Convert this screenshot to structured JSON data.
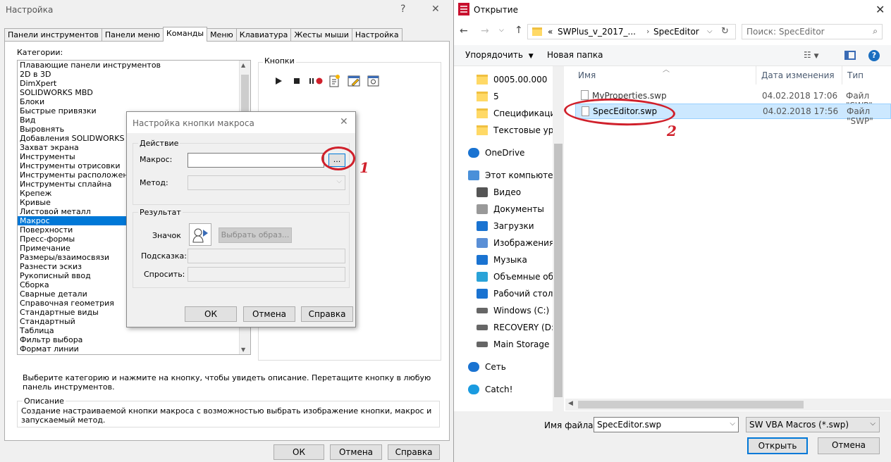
{
  "left": {
    "title": "Настройка",
    "help_glyph": "?",
    "close_glyph": "✕",
    "tabs": [
      "Панели инструментов",
      "Панели меню",
      "Команды",
      "Меню",
      "Клавиатура",
      "Жесты мыши",
      "Настройка"
    ],
    "categories_label": "Категории:",
    "buttons_label": "Кнопки",
    "categories": [
      "Плавающие панели инструментов",
      "2D в 3D",
      "DimXpert",
      "SOLIDWORKS MBD",
      "Блоки",
      "Быстрые привязки",
      "Вид",
      "Выровнять",
      "Добавления SOLIDWORKS",
      "Захват экрана",
      "Инструменты",
      "Инструменты отрисовки",
      "Инструменты расположения",
      "Инструменты сплайна",
      "Крепеж",
      "Кривые",
      "Листовой металл",
      "Макрос",
      "Поверхности",
      "Пресс-формы",
      "Примечание",
      "Размеры/взаимосвязи",
      "Разнести эскиз",
      "Рукописный ввод",
      "Сборка",
      "Сварные детали",
      "Справочная геометрия",
      "Стандартные виды",
      "Стандартный",
      "Таблица",
      "Фильтр выбора",
      "Формат линии"
    ],
    "selected_category": "Макрос",
    "hint_text": "Выберите категорию и нажмите на кнопку, чтобы увидеть описание. Перетащите кнопку в любую панель инструментов.",
    "description_label": "Описание",
    "description_text": "Создание настраиваемой кнопки макроса с возможностью выбрать изображение кнопки, макрос и запускаемый метод.",
    "ok": "ОК",
    "cancel": "Отмена",
    "help": "Справка"
  },
  "dialog": {
    "title": "Настройка кнопки макроса",
    "action_group": "Действие",
    "macro_label": "Макрос:",
    "macro_value": "",
    "browse": "...",
    "method_label": "Метод:",
    "result_group": "Результат",
    "icon_label": "Значок",
    "choose_image": "Выбрать образ...",
    "tooltip_label": "Подсказка:",
    "prompt_label": "Спросить:",
    "ok": "ОК",
    "cancel": "Отмена",
    "help": "Справка"
  },
  "annotations": {
    "one": "1",
    "two": "2"
  },
  "right": {
    "title": "Открытие",
    "path_prefix": "«",
    "path": [
      "SWPlus_v_2017_...",
      "SpecEditor"
    ],
    "search_placeholder": "Поиск: SpecEditor",
    "organize": "Упорядочить",
    "new_folder": "Новая папка",
    "col_name": "Имя",
    "col_date": "Дата изменения",
    "col_type": "Тип",
    "nav_items": [
      {
        "label": "0005.00.000",
        "icon": "folder"
      },
      {
        "label": "5",
        "icon": "folder"
      },
      {
        "label": "Спецификация",
        "icon": "folder"
      },
      {
        "label": "Текстовые урок",
        "icon": "folder"
      },
      {
        "label": "OneDrive",
        "icon": "cloud"
      },
      {
        "label": "Этот компьютер",
        "icon": "computer"
      },
      {
        "label": "Видео",
        "icon": "video"
      },
      {
        "label": "Документы",
        "icon": "documents"
      },
      {
        "label": "Загрузки",
        "icon": "download"
      },
      {
        "label": "Изображения",
        "icon": "pictures"
      },
      {
        "label": "Музыка",
        "icon": "music"
      },
      {
        "label": "Объемные объ",
        "icon": "cube"
      },
      {
        "label": "Рабочий стол",
        "icon": "desktop"
      },
      {
        "label": "Windows (C:)",
        "icon": "drive"
      },
      {
        "label": "RECOVERY (D:)",
        "icon": "drive"
      },
      {
        "label": "Main Storage (F:",
        "icon": "drive"
      },
      {
        "label": "Сеть",
        "icon": "network"
      },
      {
        "label": "Catch!",
        "icon": "catch"
      }
    ],
    "files": [
      {
        "name": "MyProperties.swp",
        "date": "04.02.2018 17:06",
        "type": "Файл \"SWP\""
      },
      {
        "name": "SpecEditor.swp",
        "date": "04.02.2018 17:56",
        "type": "Файл \"SWP\""
      }
    ],
    "filename_label": "Имя файла:",
    "filename_value": "SpecEditor.swp",
    "filter": "SW VBA Macros (*.swp)",
    "open": "Открыть",
    "cancel": "Отмена",
    "colors": {
      "accent": "#0078d7",
      "annotation": "#d0202b",
      "selection": "#cce8ff"
    }
  }
}
